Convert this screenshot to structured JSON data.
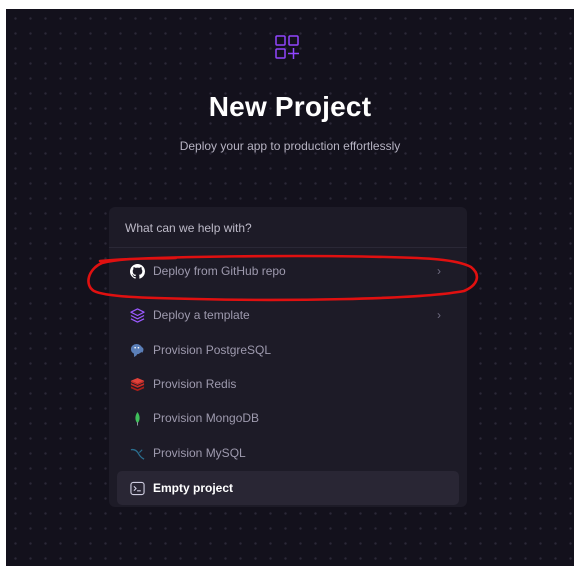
{
  "page": {
    "title": "New Project",
    "subtitle": "Deploy your app to production effortlessly"
  },
  "search": {
    "placeholder": "What can we help with?"
  },
  "menu": {
    "items": [
      {
        "label": "Deploy from GitHub repo",
        "icon": "github-icon",
        "has_chevron": true
      },
      {
        "label": "Deploy a template",
        "icon": "layers-icon",
        "has_chevron": true
      },
      {
        "label": "Provision PostgreSQL",
        "icon": "postgresql-icon",
        "has_chevron": false
      },
      {
        "label": "Provision Redis",
        "icon": "redis-icon",
        "has_chevron": false
      },
      {
        "label": "Provision MongoDB",
        "icon": "mongodb-icon",
        "has_chevron": false
      },
      {
        "label": "Provision MySQL",
        "icon": "mysql-icon",
        "has_chevron": false
      },
      {
        "label": "Empty project",
        "icon": "terminal-icon",
        "has_chevron": false,
        "selected": true
      }
    ],
    "chevron": "›"
  },
  "colors": {
    "background": "#13111c",
    "card": "#1d1b27",
    "accent": "#8b3dff",
    "annotation": "#e01010"
  }
}
